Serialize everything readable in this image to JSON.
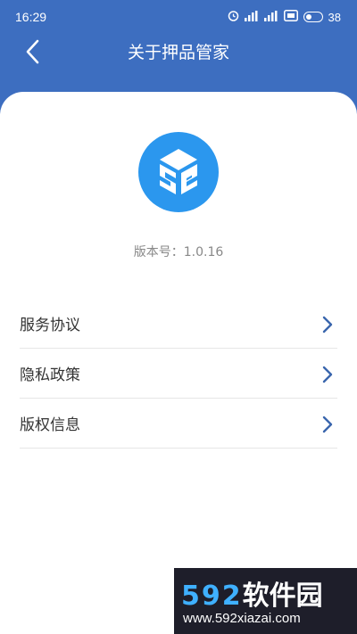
{
  "status_bar": {
    "time": "16:29",
    "battery": "38",
    "icons": [
      "alarm-icon",
      "signal-icon",
      "signal-icon",
      "hd-icon",
      "battery-icon"
    ]
  },
  "header": {
    "title": "关于押品管家",
    "back_icon": "chevron-left-icon"
  },
  "about": {
    "version_label": "版本号：",
    "version_value": "1.0.16"
  },
  "menu": {
    "items": [
      {
        "label": "服务协议"
      },
      {
        "label": "隐私政策"
      },
      {
        "label": "版权信息"
      }
    ]
  },
  "watermark": {
    "brand_number": "592",
    "brand_text": "软件园",
    "url": "www.592xiazai.com"
  },
  "colors": {
    "header_bg": "#3d6ec0",
    "logo_bg": "#2b97ee",
    "chevron": "#3a66ad"
  }
}
